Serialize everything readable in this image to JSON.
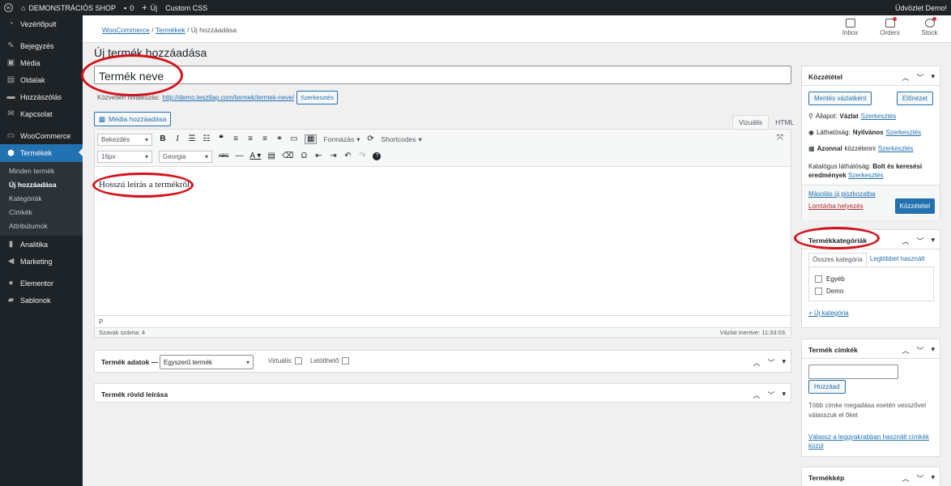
{
  "adminbar": {
    "site_name": "DEMONSTRÁCIÓS SHOP",
    "comments_count": "0",
    "new_label": "Új",
    "custom_css": "Custom CSS",
    "greeting": "Üdvözlet Demo!"
  },
  "sidebar": {
    "items_top": [
      {
        "label": "Vezérlőpult",
        "icon": "dashboard-icon"
      },
      {
        "label": "Bejegyzés",
        "icon": "pin-icon"
      },
      {
        "label": "Média",
        "icon": "media-icon"
      },
      {
        "label": "Oldalak",
        "icon": "pages-icon"
      },
      {
        "label": "Hozzászólás",
        "icon": "comments-icon"
      },
      {
        "label": "Kapcsolat",
        "icon": "mail-icon"
      }
    ],
    "woocommerce": "WooCommerce",
    "products": "Termékek",
    "submenu": [
      "Minden termék",
      "Új hozzáadása",
      "Kategóriák",
      "Címkék",
      "Attribútumok"
    ],
    "items_bottom": [
      {
        "label": "Analitika",
        "icon": "chart-icon"
      },
      {
        "label": "Marketing",
        "icon": "megaphone-icon"
      },
      {
        "label": "Elementor",
        "icon": "elementor-icon"
      },
      {
        "label": "Sablonok",
        "icon": "folder-icon"
      }
    ]
  },
  "header": {
    "breadcrumb": {
      "first": "WooCommerce",
      "second": "Termékek",
      "current": "Új hozzáadása"
    },
    "tools": [
      {
        "label": "Inbox",
        "icon": "inbox-icon"
      },
      {
        "label": "Orders",
        "icon": "orders-icon"
      },
      {
        "label": "Stock",
        "icon": "stock-icon"
      }
    ]
  },
  "main": {
    "page_title": "Új termék hozzáadása",
    "title_value": "Termék neve",
    "permalink_label": "Közvetlen hivatkozás:",
    "permalink_url": "http://demo.tesztlap.com/termek/termek-neve/",
    "permalink_edit": "Szerkesztés",
    "media_button": "Média hozzáadása",
    "tab_visual": "Vizuális",
    "tab_html": "HTML",
    "format_select": "Bekezdés",
    "font_size": "16px",
    "font_family": "Georgia",
    "formats_menu": "Formázás",
    "shortcodes_menu": "Shortcodes",
    "content": "Hosszú leírás a termékről",
    "path": "P",
    "word_count": "Szavak száma: 4",
    "draft_saved": "Vázlat mentve: 11:33:03."
  },
  "product_data": {
    "label": "Termék adatok —",
    "type_select": "Egyszerű termék",
    "virtual_label": "Virtuális:",
    "downloadable_label": "Letölthető:"
  },
  "short_desc": {
    "label": "Termék rövid leírása"
  },
  "publish": {
    "title": "Közzététel",
    "save_draft": "Mentés vázlatként",
    "preview": "Előnézet",
    "status_label": "Állapot:",
    "status_value": "Vázlat",
    "edit": "Szerkesztés",
    "visibility_label": "Láthatóság:",
    "visibility_value": "Nyilvános",
    "publish_now": "Azonnal",
    "publish_now_rest": "közzétenni",
    "catalog_label": "Katalógus láthatóság:",
    "catalog_value": "Bolt és keresési eredmények",
    "copy_draft": "Másolás új piszkozatba",
    "trash": "Lomtárba helyezés",
    "publish_button": "Közzététel"
  },
  "categories": {
    "title": "Termékkategóriák",
    "tab_all": "Összes kategória",
    "tab_popular": "Legtöbbet használt",
    "items": [
      "Egyéb",
      "Demo"
    ],
    "add_new": "+ Új kategória"
  },
  "tags": {
    "title": "Termék címkék",
    "add_button": "Hozzáad",
    "hint": "Több címke megadása esetén vesszővel válasszuk el őket",
    "choose_popular": "Válassz a leggyakrabban használt címkék közül"
  },
  "image": {
    "title": "Termékkép"
  },
  "colors": {
    "accent": "#2271b1",
    "annotation": "#d4111b",
    "sidebar": "#1d2327"
  }
}
